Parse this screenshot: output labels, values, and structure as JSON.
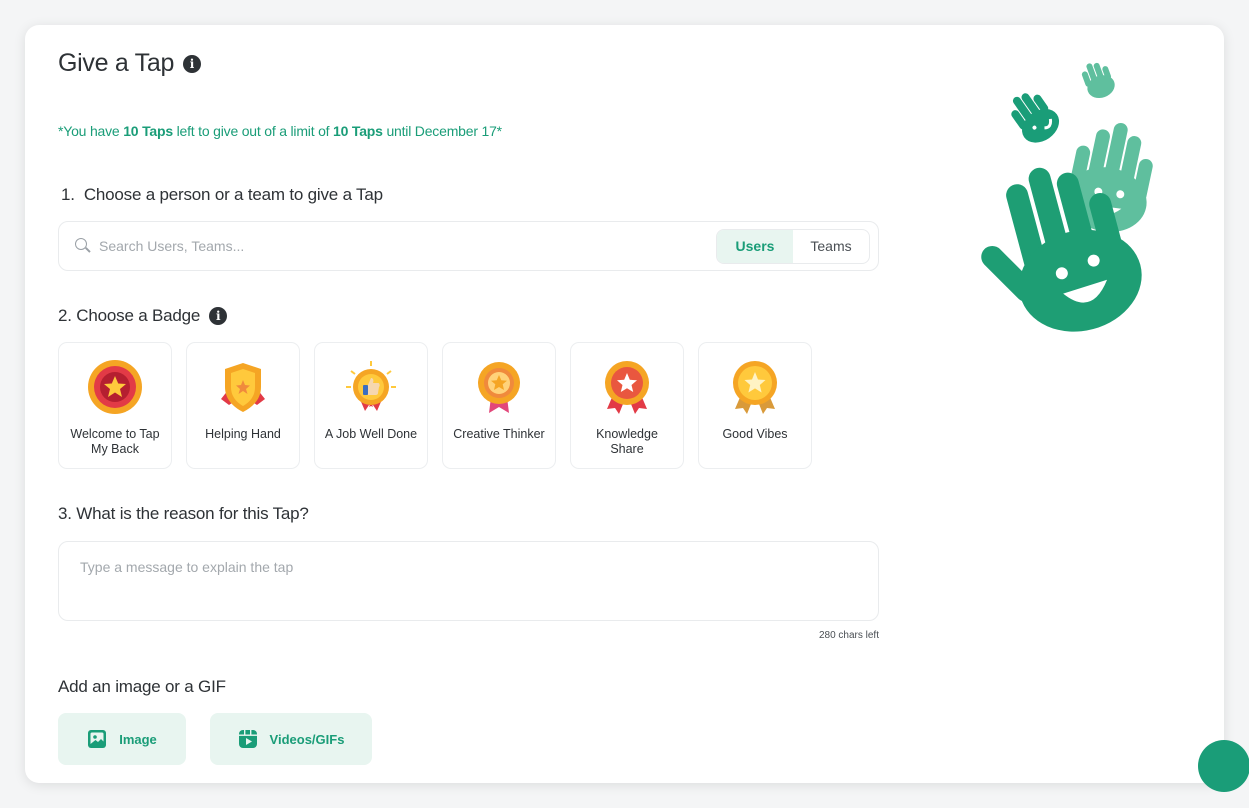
{
  "header": {
    "title": "Give a Tap"
  },
  "limit": {
    "prefix": "*You have ",
    "taps_left": "10 Taps",
    "middle": " left to give out of a limit of ",
    "taps_limit": "10 Taps",
    "suffix": " until December 17*"
  },
  "step1": {
    "label": "1.  Choose a person or a team to give a Tap",
    "search_placeholder": "Search Users, Teams...",
    "toggle_users": "Users",
    "toggle_teams": "Teams"
  },
  "step2": {
    "label": "2. Choose a Badge",
    "badges": [
      {
        "label": "Welcome to Tap My Back",
        "icon": "star-medal-icon"
      },
      {
        "label": "Helping Hand",
        "icon": "shield-badge-icon"
      },
      {
        "label": "A Job Well Done",
        "icon": "thumbs-up-medal-icon"
      },
      {
        "label": "Creative Thinker",
        "icon": "star-ribbon-medal-icon"
      },
      {
        "label": "Knowledge Share",
        "icon": "star-award-icon"
      },
      {
        "label": "Good Vibes",
        "icon": "gold-medal-icon"
      }
    ]
  },
  "step3": {
    "label": "3. What is the reason for this Tap?",
    "message_placeholder": "Type a message to explain the tap",
    "chars_left": "280 chars left"
  },
  "media": {
    "label": "Add an image or a GIF",
    "image_button": "Image",
    "video_button": "Videos/GIFs"
  },
  "colors": {
    "accent": "#1a9d78",
    "accent_light": "#e8f5f0"
  }
}
